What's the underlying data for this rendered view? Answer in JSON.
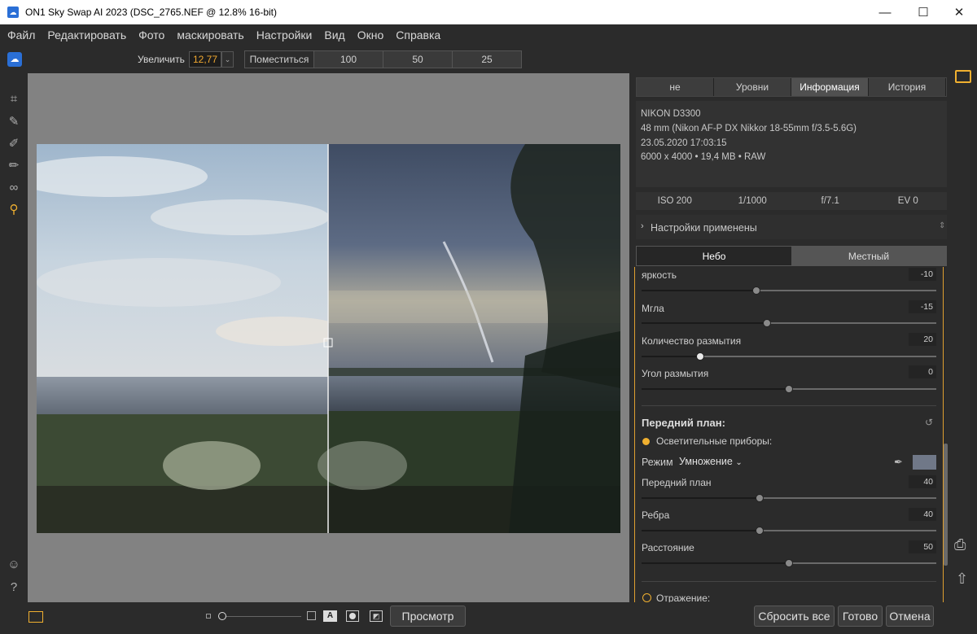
{
  "window": {
    "title": "ON1 Sky Swap AI 2023 (DSC_2765.NEF @ 12.8% 16-bit)",
    "minimize": "—",
    "maximize": "☐",
    "close": "✕"
  },
  "menu": [
    "Файл",
    "Редактировать",
    "Фото",
    "маскировать",
    "Настройки",
    "Вид",
    "Окно",
    "Справка"
  ],
  "toolbar": {
    "zoom_label": "Увеличить",
    "zoom_value": "12,77",
    "fit": "Поместиться",
    "z100": "100",
    "z50": "50",
    "z25": "25"
  },
  "panel_tabs": [
    "не",
    "Уровни",
    "Информация",
    "История"
  ],
  "info": {
    "camera": "NIKON D3300",
    "lens": "48 mm (Nikon AF-P DX Nikkor 18-55mm f/3.5-5.6G)",
    "date": "23.05.2020 17:03:15",
    "size": "6000 x 4000 • 19,4 MB • RAW"
  },
  "exif": {
    "iso": "ISO 200",
    "shutter": "1/1000",
    "aperture": "f/7.1",
    "ev": "EV 0"
  },
  "settings_applied": "Настройки применены",
  "sky_tabs": {
    "sky": "Небо",
    "local": "Местный"
  },
  "sliders": [
    {
      "label": "яркость",
      "value": "-10",
      "fraction": 0.39
    },
    {
      "label": "Мгла",
      "value": "-15",
      "fraction": 0.425
    },
    {
      "label": "Количество размытия",
      "value": "20",
      "fraction": 0.2
    },
    {
      "label": "Угол размытия",
      "value": "0",
      "fraction": 0.5
    }
  ],
  "foreground": {
    "title": "Передний план:",
    "lighting": "Осветительные приборы:",
    "mode_label": "Режим",
    "mode_value": "Умножение",
    "sliders": [
      {
        "label": "Передний план",
        "value": "40",
        "fraction": 0.4
      },
      {
        "label": "Ребра",
        "value": "40",
        "fraction": 0.4
      },
      {
        "label": "Расстояние",
        "value": "50",
        "fraction": 0.5
      }
    ],
    "reflection": "Отражение:"
  },
  "bottom": {
    "preview": "Просмотр",
    "reset_all": "Сбросить все",
    "done": "Готово",
    "cancel": "Отмена"
  },
  "colors": {
    "accent": "#e0a030",
    "bg": "#2b2b2b",
    "canvas": "#828282"
  }
}
